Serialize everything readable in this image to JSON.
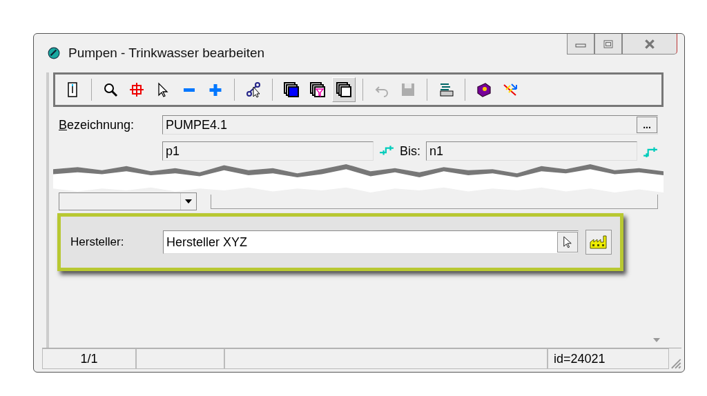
{
  "window": {
    "title": "Pumpen - Trinkwasser bearbeiten"
  },
  "toolbar": [
    [
      {
        "selected": false,
        "disabled": false
      }
    ],
    [
      {
        "selected": false,
        "disabled": false
      },
      {
        "selected": false,
        "disabled": false
      },
      {
        "selected": false,
        "disabled": false
      },
      {
        "selected": false,
        "disabled": false
      },
      {
        "selected": false,
        "disabled": false
      }
    ],
    [
      {
        "selected": false,
        "disabled": false
      }
    ],
    [
      {
        "selected": false,
        "disabled": false
      },
      {
        "selected": false,
        "disabled": false
      },
      {
        "selected": true,
        "disabled": false
      }
    ],
    [
      {
        "selected": false,
        "disabled": true
      },
      {
        "selected": false,
        "disabled": true
      }
    ],
    [
      {
        "selected": false,
        "disabled": false
      }
    ],
    [
      {
        "selected": false,
        "disabled": false
      },
      {
        "selected": false,
        "disabled": false
      }
    ]
  ],
  "form": {
    "bezeichnung": {
      "label": "Bezeichnung:",
      "value": "PUMPE4.1",
      "button": "..."
    },
    "von": {
      "value": "p1"
    },
    "bis": {
      "label": "Bis:",
      "value": "n1"
    },
    "hersteller": {
      "label": "Hersteller:",
      "value": "Hersteller XYZ"
    }
  },
  "status_bar": {
    "position": "1/1",
    "id": "id=24021"
  }
}
